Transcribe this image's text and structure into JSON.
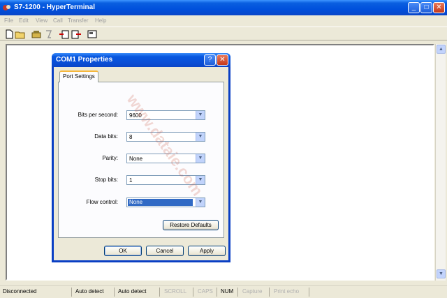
{
  "app": {
    "title": "S7-1200 - HyperTerminal",
    "window_buttons": {
      "minimize": "_",
      "maximize": "□",
      "close": "✕"
    }
  },
  "menu": [
    "File",
    "Edit",
    "View",
    "Call",
    "Transfer",
    "Help"
  ],
  "toolbar": [
    "new-icon",
    "open-icon",
    "dial-icon",
    "disconnect-icon",
    "send-icon",
    "receive-icon",
    "properties-icon"
  ],
  "status": {
    "connection": "Disconnected",
    "detect1": "Auto detect",
    "detect2": "Auto detect",
    "scroll": "SCROLL",
    "caps": "CAPS",
    "num": "NUM",
    "capture": "Capture",
    "print_echo": "Print echo"
  },
  "dialog": {
    "title": "COM1 Properties",
    "help_button": "?",
    "close_button": "✕",
    "tab": "Port Settings",
    "fields": {
      "bits_per_second": {
        "label": "Bits per second:",
        "value": "9600"
      },
      "data_bits": {
        "label": "Data bits:",
        "value": "8"
      },
      "parity": {
        "label": "Parity:",
        "value": "None"
      },
      "stop_bits": {
        "label": "Stop bits:",
        "value": "1"
      },
      "flow_control": {
        "label": "Flow control:",
        "value": "None"
      }
    },
    "restore_defaults": "Restore Defaults",
    "ok": "OK",
    "cancel": "Cancel",
    "apply": "Apply"
  },
  "watermark": "www.dataie.com"
}
